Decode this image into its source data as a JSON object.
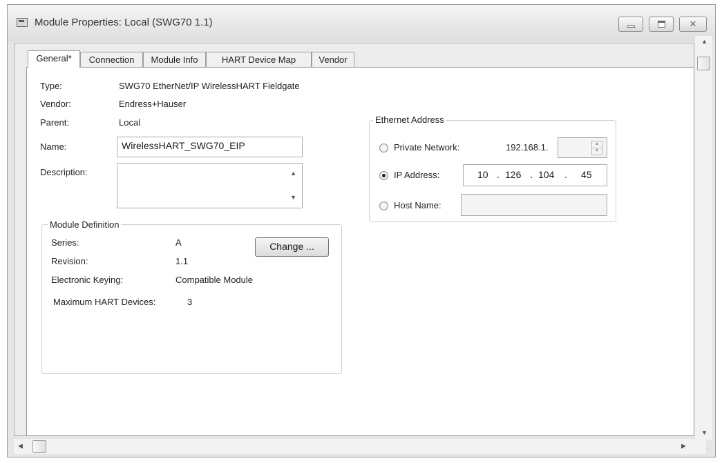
{
  "window": {
    "title": "Module Properties: Local (SWG70 1.1)"
  },
  "tabs": [
    {
      "label": "General*"
    },
    {
      "label": "Connection"
    },
    {
      "label": "Module Info"
    },
    {
      "label": "HART Device Map"
    },
    {
      "label": "Vendor"
    }
  ],
  "general": {
    "type_label": "Type:",
    "type_value": "SWG70 EtherNet/IP WirelessHART Fieldgate",
    "vendor_label": "Vendor:",
    "vendor_value": "Endress+Hauser",
    "parent_label": "Parent:",
    "parent_value": "Local",
    "name_label": "Name:",
    "name_value": "WirelessHART_SWG70_EIP",
    "description_label": "Description:",
    "description_value": ""
  },
  "module_definition": {
    "title": "Module Definition",
    "series_label": "Series:",
    "series_value": "A",
    "revision_label": "Revision:",
    "revision_value": "1.1",
    "keying_label": "Electronic Keying:",
    "keying_value": "Compatible Module",
    "max_hart_label": "Maximum HART Devices:",
    "max_hart_value": "3",
    "change_button": "Change ..."
  },
  "ethernet": {
    "title": "Ethernet Address",
    "private_label": "Private Network:",
    "private_prefix": "192.168.1.",
    "private_value": "",
    "private_selected": false,
    "ip_label": "IP Address:",
    "ip_selected": true,
    "ip_octets": [
      "10",
      "126",
      "104",
      "45"
    ],
    "host_label": "Host Name:",
    "host_value": "",
    "host_selected": false
  },
  "icons": {
    "minimize": "minimize-icon",
    "restore": "restore-icon",
    "close": "close-icon"
  }
}
